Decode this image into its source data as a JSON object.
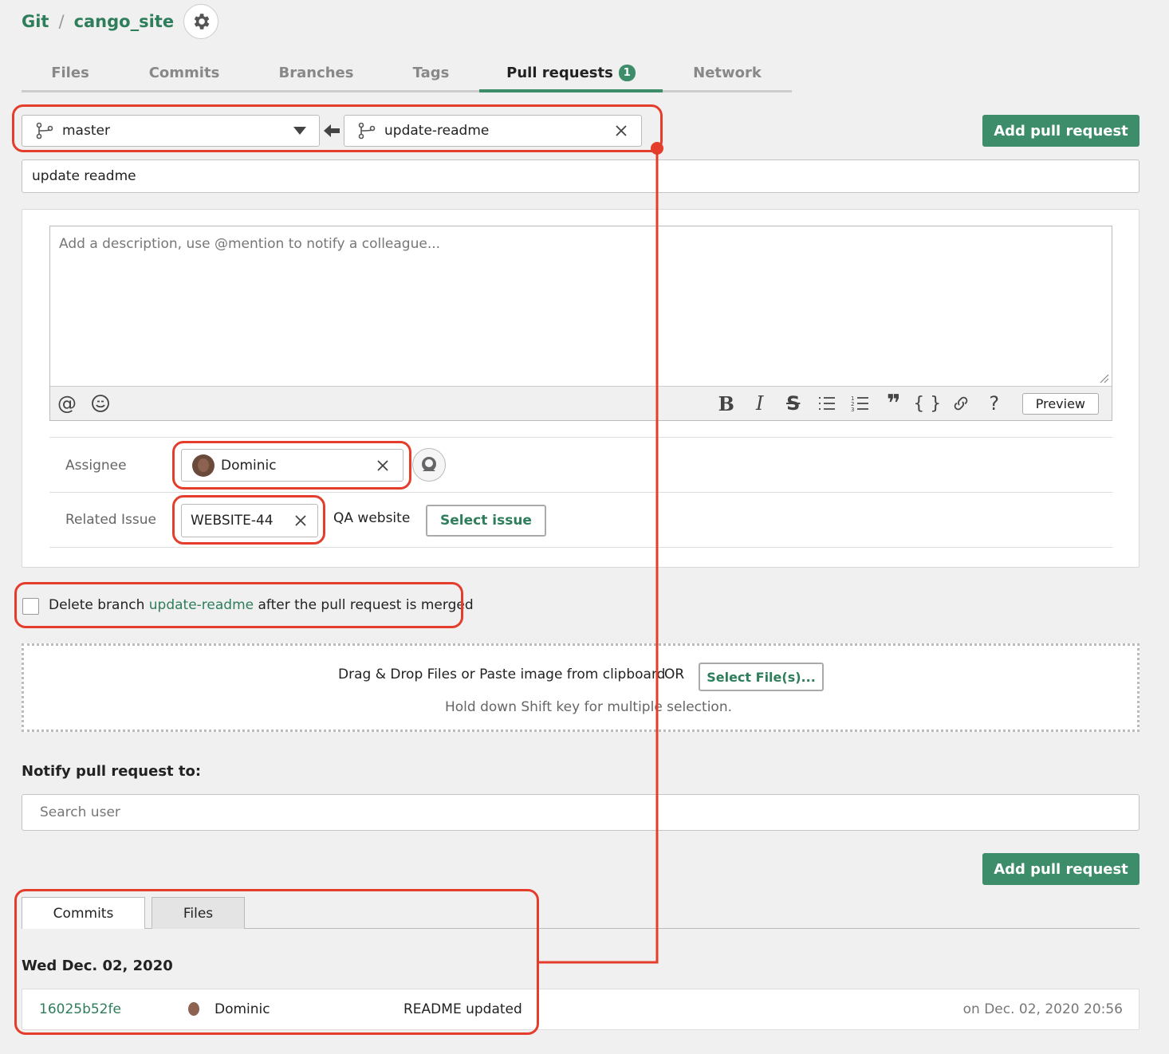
{
  "breadcrumb": {
    "root": "Git",
    "separator": "/",
    "repo": "cango_site"
  },
  "tabs": [
    {
      "label": "Files"
    },
    {
      "label": "Commits"
    },
    {
      "label": "Branches"
    },
    {
      "label": "Tags"
    },
    {
      "label": "Pull requests",
      "badge": "1",
      "active": true
    },
    {
      "label": "Network"
    }
  ],
  "form": {
    "target_branch": "master",
    "source_branch": "update-readme",
    "add_button": "Add pull request",
    "title_value": "update readme",
    "description_placeholder": "Add a description, use @mention to notify a colleague...",
    "preview_label": "Preview",
    "assignee_label": "Assignee",
    "assignee_value": "Dominic",
    "related_issue_label": "Related Issue",
    "related_issue_value": "WEBSITE-44",
    "related_issue_title": "QA website",
    "select_issue": "Select issue",
    "delete_branch": {
      "prefix": "Delete branch ",
      "branch": "update-readme",
      "suffix": " after the pull request is merged",
      "checked": false
    },
    "dropzone_text": "Drag & Drop Files or Paste image from clipboard",
    "dropzone_or": "OR",
    "select_files": "Select File(s)...",
    "dropzone_hint": "Hold down Shift key for multiple selection.",
    "notify_label": "Notify pull request to:",
    "search_user_placeholder": "Search user"
  },
  "bottom_tabs": [
    {
      "label": "Commits"
    },
    {
      "label": "Files"
    }
  ],
  "commit_group": {
    "date": "Wed Dec. 02, 2020",
    "commits": [
      {
        "hash": "16025b52fe",
        "author": "Dominic",
        "message": "README updated",
        "time": "on Dec. 02, 2020 20:56"
      }
    ]
  },
  "colors": {
    "accent": "#3d8c6a",
    "highlight": "#e43d2c"
  }
}
